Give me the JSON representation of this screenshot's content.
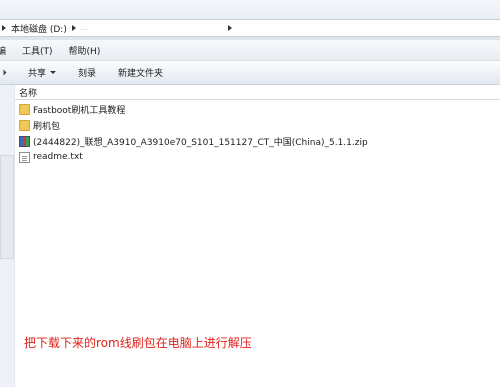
{
  "address": {
    "crumb1": "本地磁盘 (D:)",
    "crumb2": "▸",
    "blurred_text": "...",
    "arrow_left_icon": "breadcrumb-arrow-icon"
  },
  "menubar": {
    "items": [
      {
        "label": "编"
      },
      {
        "label": "工具(T)"
      },
      {
        "label": "帮助(H)"
      }
    ]
  },
  "toolbar": {
    "items": [
      {
        "label": "共享"
      },
      {
        "label": "刻录"
      },
      {
        "label": "新建文件夹"
      }
    ]
  },
  "columns": {
    "name": "名称"
  },
  "files": [
    {
      "name": "Fastboot刷机工具教程",
      "icon": "folder-icon"
    },
    {
      "name": "刷机包",
      "icon": "folder-icon"
    },
    {
      "name": "(2444822)_联想_A3910_A3910e70_S101_151127_CT_中国(China)_5.1.1.zip",
      "icon": "zip-archive-icon"
    },
    {
      "name": "readme.txt",
      "icon": "text-file-icon"
    }
  ],
  "annotation": {
    "text": "把下载下来的rom线刷包在电脑上进行解压",
    "color": "#e0221c"
  }
}
